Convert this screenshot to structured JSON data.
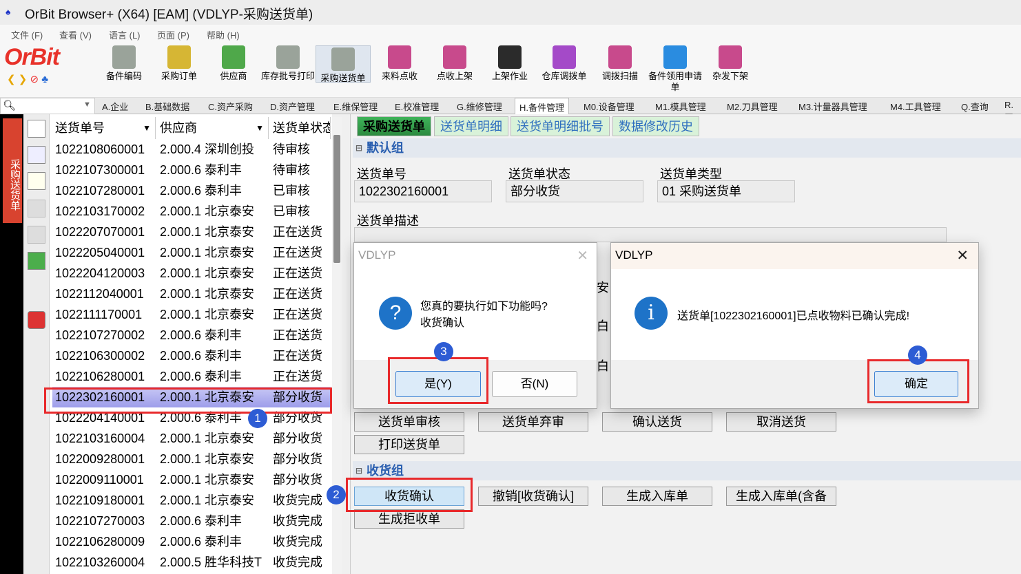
{
  "window": {
    "title": "OrBit Browser+ (X64) [EAM] (VDLYP-采购送货单)"
  },
  "menu": [
    "文件 (F)",
    "查看 (V)",
    "语言 (L)",
    "页面 (P)",
    "帮助 (H)"
  ],
  "brand": "OrBit",
  "toolbar": [
    "备件编码",
    "采购订单",
    "供应商",
    "库存批号打印",
    "采购送货单",
    "来料点收",
    "点收上架",
    "上架作业",
    "仓库调拨单",
    "调拨扫描",
    "备件领用申请单",
    "杂发下架"
  ],
  "modules": [
    "A.企业",
    "B.基础数据",
    "C.资产采购",
    "D.资产管理",
    "E.维保管理",
    "E.校准管理",
    "G.维修管理",
    "H.备件管理",
    "M0.设备管理",
    "M1.模具管理",
    "M2.刀具管理",
    "M3.计量器具管理",
    "M4.工具管理",
    "Q.查询",
    "R.工"
  ],
  "vertical_tab": "采购送货单",
  "list": {
    "headers": [
      "送货单号",
      "供应商",
      "送货单状态"
    ],
    "rows": [
      [
        "1022108060001",
        "2.000.4 深圳创投",
        "待审核"
      ],
      [
        "1022107300001",
        "2.000.6 泰利丰",
        "待审核"
      ],
      [
        "1022107280001",
        "2.000.6 泰利丰",
        "已审核"
      ],
      [
        "1022103170002",
        "2.000.1 北京泰安",
        "已审核"
      ],
      [
        "1022207070001",
        "2.000.1 北京泰安",
        "正在送货"
      ],
      [
        "1022205040001",
        "2.000.1 北京泰安",
        "正在送货"
      ],
      [
        "1022204120003",
        "2.000.1 北京泰安",
        "正在送货"
      ],
      [
        "1022112040001",
        "2.000.1 北京泰安",
        "正在送货"
      ],
      [
        "1022111170001",
        "2.000.1 北京泰安",
        "正在送货"
      ],
      [
        "1022107270002",
        "2.000.6 泰利丰",
        "正在送货"
      ],
      [
        "1022106300002",
        "2.000.6 泰利丰",
        "正在送货"
      ],
      [
        "1022106280001",
        "2.000.6 泰利丰",
        "正在送货"
      ],
      [
        "1022302160001",
        "2.000.1 北京泰安",
        "部分收货"
      ],
      [
        "1022204140001",
        "2.000.6 泰利丰",
        "部分收货"
      ],
      [
        "1022103160004",
        "2.000.1 北京泰安",
        "部分收货"
      ],
      [
        "1022009280001",
        "2.000.1 北京泰安",
        "部分收货"
      ],
      [
        "1022009110001",
        "2.000.1 北京泰安",
        "部分收货"
      ],
      [
        "1022109180001",
        "2.000.1 北京泰安",
        "收货完成"
      ],
      [
        "1022107270003",
        "2.000.6 泰利丰",
        "收货完成"
      ],
      [
        "1022106280009",
        "2.000.6 泰利丰",
        "收货完成"
      ],
      [
        "1022103260004",
        "2.000.5 胜华科技T",
        "收货完成"
      ]
    ]
  },
  "detail_tabs": [
    "采购送货单",
    "送货单明细",
    "送货单明细批号",
    "数据修改历史"
  ],
  "default_group": {
    "title": "默认组",
    "fields": [
      {
        "label": "送货单号",
        "value": "1022302160001"
      },
      {
        "label": "送货单状态",
        "value": "部分收货"
      },
      {
        "label": "送货单类型",
        "value": "01 采购送货单"
      },
      {
        "label": "送货单描述",
        "value": ""
      }
    ]
  },
  "action_buttons": [
    "送货单审核",
    "送货单弃审",
    "确认送货",
    "取消送货",
    "打印送货单"
  ],
  "receive_group": {
    "title": "收货组",
    "buttons": [
      "收货确认",
      "撤销[收货确认]",
      "生成入库单",
      "生成入库单(含备",
      "生成拒收单"
    ]
  },
  "confirm_dialog": {
    "title": "VDLYP",
    "line1": "您真的要执行如下功能吗?",
    "line2": "收货确认",
    "yes": "是(Y)",
    "no": "否(N)"
  },
  "info_dialog": {
    "title": "VDLYP",
    "message": "送货单[1022302160001]已点收物料已确认完成!",
    "ok": "确定"
  },
  "badges": [
    "1",
    "2",
    "3",
    "4"
  ],
  "partial_chars": [
    "安",
    "白",
    "白"
  ]
}
